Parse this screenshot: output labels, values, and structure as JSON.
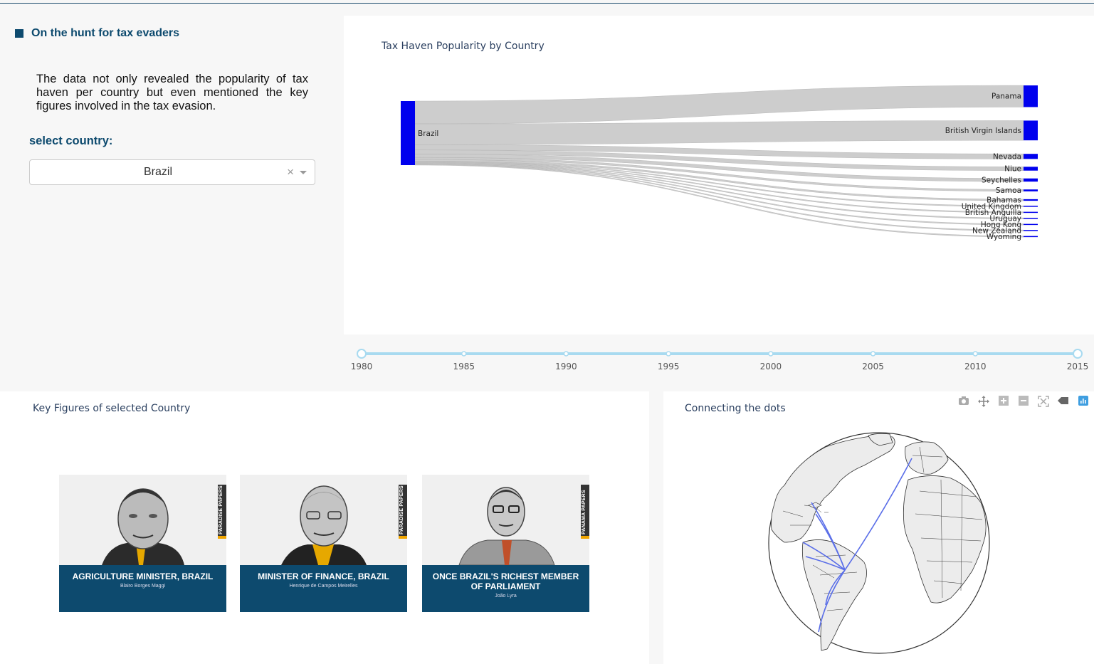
{
  "header": {
    "title": "On the hunt for tax evaders",
    "description": "The data not only revealed the popularity of tax haven per country but even mentioned the key figures involved in the tax evasion."
  },
  "selector": {
    "label": "select country:",
    "value": "Brazil",
    "clear_icon": "close-icon",
    "arrow_icon": "chevron-down-icon"
  },
  "sankey": {
    "title": "Tax Haven Popularity by Country",
    "source": "Brazil",
    "node_color": "#0000ee",
    "link_color": "#c8c8c8",
    "targets": [
      {
        "name": "Panama",
        "value": 34
      },
      {
        "name": "British Virgin Islands",
        "value": 31
      },
      {
        "name": "Nevada",
        "value": 8
      },
      {
        "name": "Niue",
        "value": 6
      },
      {
        "name": "Seychelles",
        "value": 5
      },
      {
        "name": "Samoa",
        "value": 3
      },
      {
        "name": "Bahamas",
        "value": 2.5
      },
      {
        "name": "United Kingdom",
        "value": 1
      },
      {
        "name": "British Anguilla",
        "value": 1
      },
      {
        "name": "Uruguay",
        "value": 1
      },
      {
        "name": "Hong Kong",
        "value": 1
      },
      {
        "name": "New Zealand",
        "value": 1
      },
      {
        "name": "Wyoming",
        "value": 1
      }
    ]
  },
  "timeline": {
    "marks": [
      "1980",
      "1985",
      "1990",
      "1995",
      "2000",
      "2005",
      "2010",
      "2015"
    ],
    "range": [
      "1980",
      "2015"
    ],
    "color": "#a8daf0"
  },
  "key_figures": {
    "title": "Key Figures of selected Country",
    "cards": [
      {
        "tag": "PARADISE PAPERS",
        "role": "AGRICULTURE MINISTER, BRAZIL",
        "person": "Blairo Borges Maggi"
      },
      {
        "tag": "PARADISE PAPERS",
        "role": "MINISTER OF FINANCE, BRAZIL",
        "person": "Henrique de Campos Meirelles"
      },
      {
        "tag": "PANAMA PAPERS",
        "role": "ONCE BRAZIL'S RICHEST MEMBER OF PARLIAMENT",
        "person": "João Lyra"
      }
    ]
  },
  "globe": {
    "title": "Connecting the dots",
    "route_color": "#5a6ee8",
    "modebar": [
      "camera-icon",
      "pan-icon",
      "zoom-in-icon",
      "zoom-out-icon",
      "reset-icon",
      "eraser-icon",
      "plotly-logo-icon"
    ]
  }
}
